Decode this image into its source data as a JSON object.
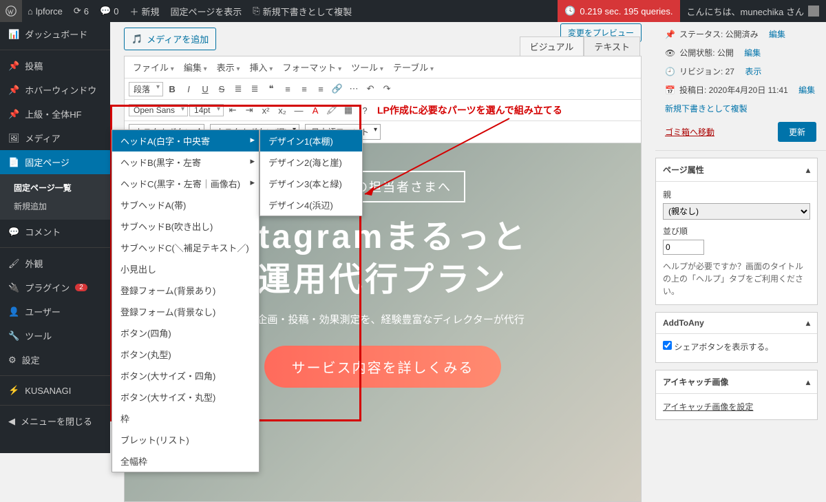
{
  "topbar": {
    "site": "lpforce",
    "updates": "6",
    "comments": "0",
    "new": "新規",
    "show_page": "固定ページを表示",
    "duplicate": "新規下書きとして複製",
    "perf": "0.219 sec. 195 queries.",
    "howdy": "こんにちは、munechika さん"
  },
  "sidebar_groups": [
    {
      "items": [
        [
          "dashboard",
          "ダッシュボード"
        ]
      ]
    },
    {
      "items": [
        [
          "posts",
          "投稿"
        ],
        [
          "hover",
          "ホバーウィンドウ"
        ],
        [
          "hf",
          "上級・全体HF"
        ],
        [
          "media",
          "メディア"
        ],
        [
          "pages",
          "固定ページ"
        ]
      ],
      "current": "pages",
      "subs": [
        [
          "list",
          "固定ページ一覧",
          true
        ],
        [
          "addnew",
          "新規追加",
          false
        ]
      ]
    },
    {
      "items": [
        [
          "comments",
          "コメント"
        ]
      ]
    },
    {
      "items": [
        [
          "appearance",
          "外観"
        ],
        [
          "plugins",
          "プラグイン"
        ],
        [
          "users",
          "ユーザー"
        ],
        [
          "tools",
          "ツール"
        ],
        [
          "settings",
          "設定"
        ]
      ],
      "plugin_badge": "2"
    },
    {
      "items": [
        [
          "kusanagi",
          "KUSANAGI"
        ]
      ]
    },
    {
      "items": [
        [
          "collapse",
          "メニューを閉じる"
        ]
      ]
    }
  ],
  "buttons": {
    "preview": "変更をプレビュー",
    "add_media": "メディアを追加",
    "update": "更新"
  },
  "tabs": {
    "visual": "ビジュアル",
    "text": "テキスト"
  },
  "menubar": [
    "ファイル",
    "編集",
    "表示",
    "挿入",
    "フォーマット",
    "ツール",
    "テーブル"
  ],
  "row2": {
    "format": "段落"
  },
  "row3": {
    "font": "Open Sans",
    "size": "14pt"
  },
  "row4": {
    "btn1": "カスタムボタン",
    "btn2": "カスタムボタン(旧)",
    "btn3": "日本語フォント"
  },
  "dropdown": {
    "items": [
      "ヘッドA(白字・中央寄",
      "ヘッドB(黒字・左寄",
      "ヘッドC(黒字・左寄｜画像右)",
      "サブヘッドA(帯)",
      "サブヘッドB(吹き出し)",
      "サブヘッドC(＼補足テキスト／)",
      "小見出し",
      "登録フォーム(背景あり)",
      "登録フォーム(背景なし)",
      "ボタン(四角)",
      "ボタン(丸型)",
      "ボタン(大サイズ・四角)",
      "ボタン(大サイズ・丸型)",
      "枠",
      "ブレット(リスト)",
      "全幅枠"
    ],
    "sub": [
      "デザイン1(本棚)",
      "デザイン2(海と崖)",
      "デザイン3(本と緑)",
      "デザイン4(浜辺)"
    ]
  },
  "hero": {
    "pre": "お困りの担当者さまへ",
    "title_a": "stagramまるっと",
    "title_b": "運用代行プラン",
    "sub": "nの企画・投稿・効果測定を、経験豊富なディレクターが代行",
    "cta": "サービス内容を詳しくみる"
  },
  "annotation": "LP作成に必要なパーツを選んで組み立てる",
  "publish": {
    "status": "ステータス: 公開済み",
    "status_edit": "編集",
    "visibility": "公開状態: 公開",
    "vis_edit": "編集",
    "revisions": "リビジョン: 27",
    "rev_link": "表示",
    "date": "投稿日: 2020年4月20日 11:41",
    "date_edit": "編集",
    "copy_draft": "新規下書きとして複製",
    "trash": "ゴミ箱へ移動"
  },
  "panels": {
    "attr": {
      "title": "ページ属性",
      "parent": "親",
      "parent_val": "(親なし)",
      "order": "並び順",
      "order_val": "0",
      "help": "ヘルプが必要ですか？画面のタイトルの上の「ヘルプ」タブをご利用ください。"
    },
    "a2a": {
      "title": "AddToAny",
      "chk": "シェアボタンを表示する。"
    },
    "feat": {
      "title": "アイキャッチ画像",
      "link": "アイキャッチ画像を設定"
    }
  }
}
